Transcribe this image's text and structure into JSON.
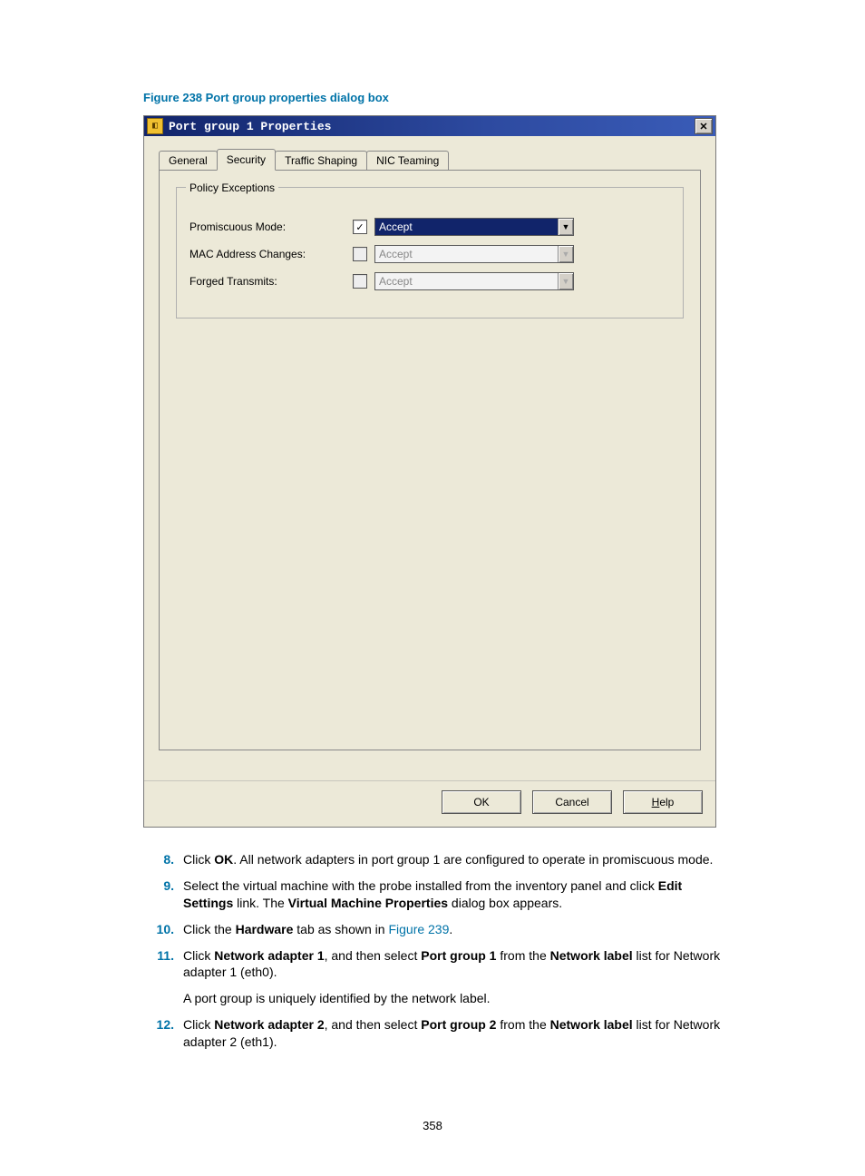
{
  "figure_caption": "Figure 238 Port group properties dialog box",
  "dialog": {
    "title": "Port group 1 Properties",
    "tabs": [
      "General",
      "Security",
      "Traffic Shaping",
      "NIC Teaming"
    ],
    "active_tab": 1,
    "fieldset_legend": "Policy Exceptions",
    "rows": [
      {
        "label": "Promiscuous Mode:",
        "checked": true,
        "value": "Accept",
        "enabled": true
      },
      {
        "label": "MAC Address Changes:",
        "checked": false,
        "value": "Accept",
        "enabled": false
      },
      {
        "label": "Forged Transmits:",
        "checked": false,
        "value": "Accept",
        "enabled": false
      }
    ],
    "buttons": {
      "ok": "OK",
      "cancel": "Cancel",
      "help_prefix": "H",
      "help_rest": "elp"
    }
  },
  "steps": {
    "s8": {
      "num": "8.",
      "pre": "Click ",
      "b1": "OK",
      "post": ". All network adapters in port group 1 are configured to operate in promiscuous mode."
    },
    "s9": {
      "num": "9.",
      "pre": "Select the virtual machine with the probe installed from the inventory panel and click ",
      "b1": "Edit Settings",
      "mid": " link. The ",
      "b2": "Virtual Machine Properties",
      "post": " dialog box appears."
    },
    "s10": {
      "num": "10.",
      "pre": "Click the ",
      "b1": "Hardware",
      "mid": " tab as shown in ",
      "link": "Figure 239",
      "post": "."
    },
    "s11": {
      "num": "11.",
      "pre": "Click ",
      "b1": "Network adapter 1",
      "mid1": ", and then select ",
      "b2": "Port group 1",
      "mid2": " from the ",
      "b3": "Network label",
      "post": " list for Network adapter 1 (eth0)."
    },
    "s11_sub": "A port group is uniquely identified by the network label.",
    "s12": {
      "num": "12.",
      "pre": "Click ",
      "b1": "Network adapter 2",
      "mid1": ", and then select ",
      "b2": "Port group 2",
      "mid2": " from the ",
      "b3": "Network label",
      "post": " list for Network adapter 2 (eth1)."
    }
  },
  "page_number": "358"
}
